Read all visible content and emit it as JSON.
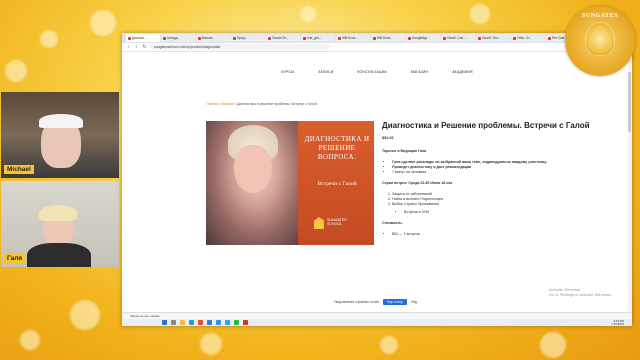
{
  "browser": {
    "tabs": [
      "Диагнос...",
      "Ангард...",
      "Ватсап...",
      "Пред...",
      "Oracle Gr...",
      "nna_grd...",
      "WB Krow...",
      "WB Krow...",
      "GoogleAgr...",
      "Ошиб. Сел...",
      "Ошиб. Тел...",
      "Табл. Сч.",
      "Per Сим..."
    ],
    "url": "sungatesschool.ru/shop/product/diagnostika"
  },
  "site_nav": [
    "КУРСЫ",
    "ЗАПИСИ",
    "КОНСУЛЬТАЦИИ",
    "МАГАЗИН",
    "АКАДЕМИЯ"
  ],
  "breadcrumb": {
    "home": "Главная",
    "sep1": " / ",
    "shop": "Магазин",
    "sep2": " / ",
    "current": "Диагностика и решение проблемы. Встречи с Галой"
  },
  "product_image": {
    "title": "ДИАГНОСТИКА И РЕШЕНИЕ ВОПРОСА.",
    "subtitle": "Встречи с Галой",
    "logo_text": "SUNGATES SCHOOL"
  },
  "product": {
    "title": "Диагностика и Решение проблемы. Встречи с Галой",
    "price": "$52.00",
    "host_line": "Таролог и Видящая  Гала",
    "bullets": [
      "Гала сделает расклады по выбранной вами теме, индивидуально каждому участнику.",
      "Проведет диагностику и даст рекомендации",
      "7 минут на человека"
    ],
    "schedule": "Серия встреч: Среда 23.30   Июля 18 иск",
    "steps": [
      "Защита от заболеваний",
      "Найти и выгнать Подселенцев",
      "Выбор Страны Проживания"
    ],
    "sub_item": "Встреча в ЗУМ",
    "cost_label": "Стоимость:",
    "cost_item": "$52 — 1 встреча"
  },
  "cookie": {
    "text": "Уведомление о файлах cookie",
    "accept": "Мэр Аххор",
    "other": "Обд"
  },
  "activate": {
    "line1": "Activate Windows",
    "line2": "Go to Settings to activate Windows."
  },
  "downloads": {
    "item": "Запись встреч нажав"
  },
  "tray": {
    "time": "9:03 PM",
    "date": "7/16/2024"
  },
  "participants": [
    {
      "name": "Michael"
    },
    {
      "name": "Галя"
    }
  ],
  "logo": {
    "text": "SUNGATES"
  },
  "colors": {
    "accent": "#d38a1c",
    "card_orange": "#d95f2e",
    "name_tag": "#f6c431",
    "cookie_button": "#1e6fd9"
  }
}
